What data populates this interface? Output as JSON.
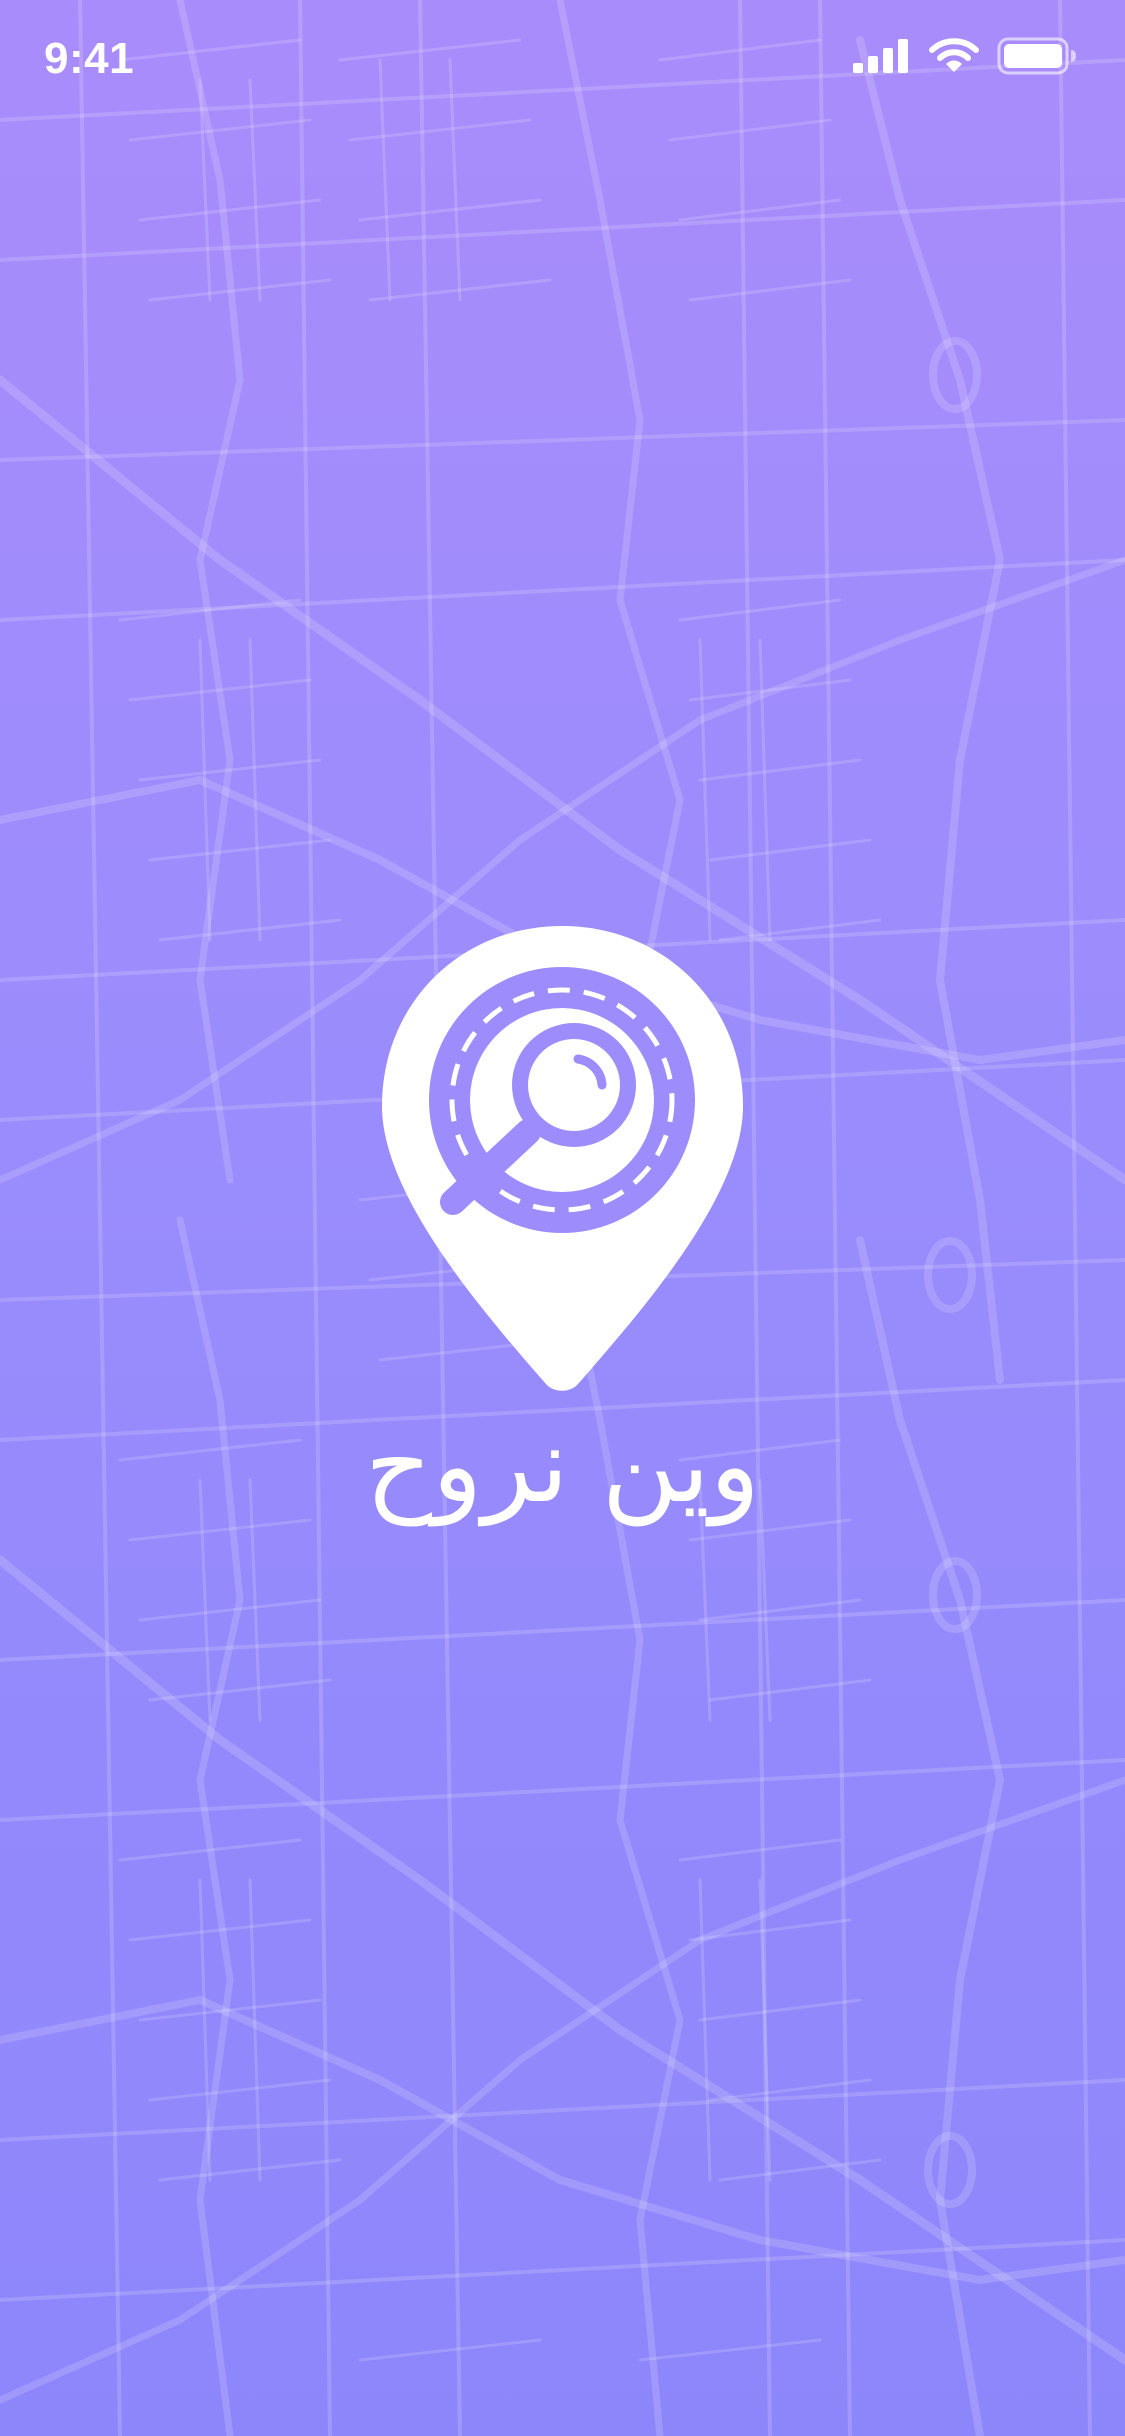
{
  "status_bar": {
    "time": "9:41",
    "icons": [
      "cellular-signal-icon",
      "wifi-icon",
      "battery-icon"
    ]
  },
  "splash": {
    "app_name": "وين نروح",
    "logo_icon": "map-pin-magnifier-icon",
    "background": "city-map-pattern"
  },
  "colors": {
    "background_top": "#a98cfb",
    "background_bottom": "#8d86fb",
    "logo_accent": "#9c8cfc",
    "foreground": "#ffffff"
  }
}
